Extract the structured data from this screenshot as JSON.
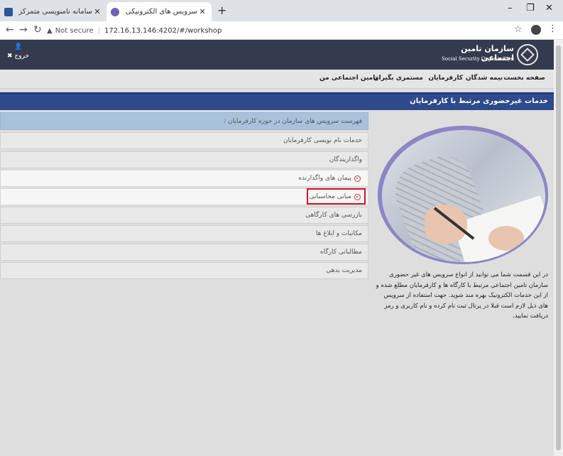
{
  "browser": {
    "tabs": [
      {
        "title": "سامانه نامنویسی متمرکز کارگاه و ...",
        "active": false
      },
      {
        "title": "سرویس های الکترونیکی سازمان تام...",
        "active": true
      }
    ],
    "url_status": "Not secure",
    "url": "172.16.13.146:4202/#/workshop"
  },
  "header": {
    "logout_label": "خروج",
    "logo_fa": "سازمان تامین اجتماعی",
    "logo_en": "Social Security Organization"
  },
  "menu": {
    "items": [
      "صفحه نخست",
      "بیمه شدگان",
      "کارفرمایان",
      "مستمری بگیران",
      "تامین اجتماعی من"
    ]
  },
  "page": {
    "title": "خدمات غیرحضوری مرتبط با کارفرمایان"
  },
  "services": {
    "heading": "فهرست سرویس های سازمان در حوزه کارفرمایان :",
    "items": [
      {
        "label": "خدمات نام نویسی کارفرمایان",
        "sub": false,
        "icon": false
      },
      {
        "label": "واگذاریندگان",
        "sub": false,
        "icon": false
      },
      {
        "label": "پیمان های واگذارنده",
        "sub": true,
        "icon": true
      },
      {
        "label": "مبانی محاسباتی",
        "sub": true,
        "icon": true,
        "highlighted": true
      },
      {
        "label": "بازرسی های کارگاهی",
        "sub": false,
        "icon": false
      },
      {
        "label": "مکاتبات و ابلاغ ها",
        "sub": false,
        "icon": false
      },
      {
        "label": "مطالباتی کارگاه",
        "sub": false,
        "icon": false
      },
      {
        "label": "مدیریت بدهی",
        "sub": false,
        "icon": false
      }
    ]
  },
  "description": "در این قسمت شما می توانید از انواع سرویس های غیر حضوری سازمان تامین اجتماعی مرتبط با کارگاه ها و کارفرمایان مطلع شده و از این خدمات الکترونیک بهره مند شوید. جهت استفاده از سرویس های ذیل لازم است قبلا در پرتال ثبت نام کرده و نام کاربری و رمز دریافت نمایید.",
  "colors": {
    "header_bg": "#343b4e",
    "title_bar": "#2f4a8a",
    "list_heading": "#a8c2dc",
    "highlight": "#d01225"
  }
}
